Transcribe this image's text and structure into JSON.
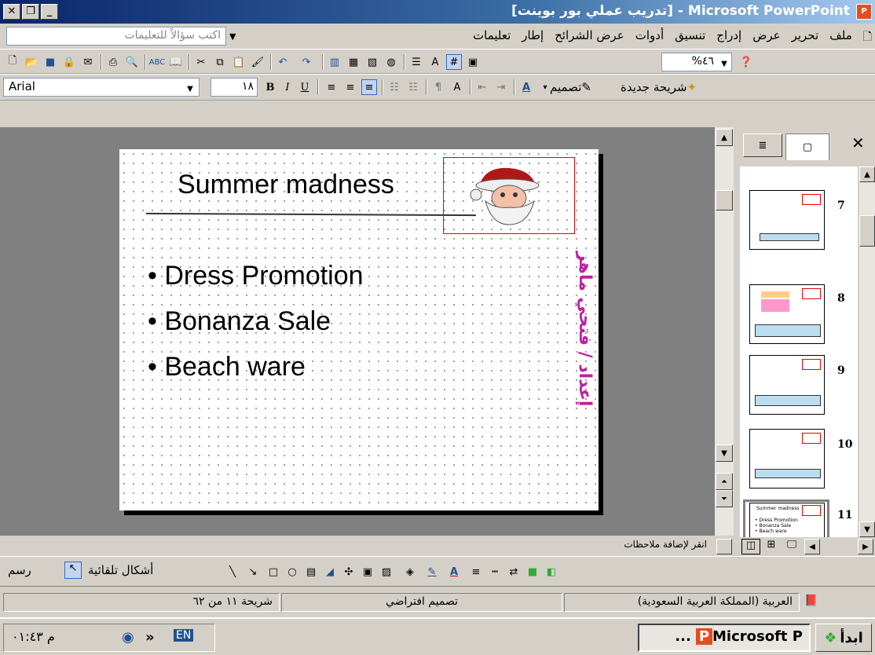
{
  "window": {
    "title": "Microsoft PowerPoint - [تدريب عملي بور بوينت]",
    "app_icon": "powerpoint-icon"
  },
  "menu": {
    "items": [
      "ملف",
      "تحرير",
      "عرض",
      "إدراج",
      "تنسيق",
      "أدوات",
      "عرض الشرائح",
      "إطار",
      "تعليمات"
    ],
    "ask_placeholder": "اكتب سؤالاً للتعليمات"
  },
  "standard_toolbar": {
    "zoom": "%٤٦"
  },
  "format_toolbar": {
    "font": "Arial",
    "size": "١٨",
    "bold": "B",
    "italic": "I",
    "underline": "U",
    "design_label": "تصميم",
    "new_slide_label": "شريحة جديدة"
  },
  "slide": {
    "title": "Summer madness",
    "bullets": [
      "• Dress Promotion",
      "• Bonanza Sale",
      "• Beach ware"
    ],
    "vertical_text": "إعداد / فتحي ماهر"
  },
  "thumbnails": [
    {
      "num": "7"
    },
    {
      "num": "8"
    },
    {
      "num": "9"
    },
    {
      "num": "10"
    },
    {
      "num": "11"
    }
  ],
  "thumb11": {
    "title": "Summer madness",
    "lines": [
      "• Dress Promotion",
      "• Bonanza Sale",
      "• Beach ware"
    ]
  },
  "notes": {
    "placeholder": "انقر لإضافة ملاحظات"
  },
  "draw_toolbar": {
    "draw_label": "رسم",
    "autoshapes_label": "أشكال تلقائية"
  },
  "status": {
    "slide": "شريحة ١١ من ٦٢",
    "design": "تصميم افتراضي",
    "language": "العربية (المملكة العربية السعودية)"
  },
  "taskbar": {
    "start": "ابدأ",
    "task": "Microsoft P...",
    "time": "م ٠١:٤٣",
    "lang": "EN",
    "chevron": "»"
  }
}
